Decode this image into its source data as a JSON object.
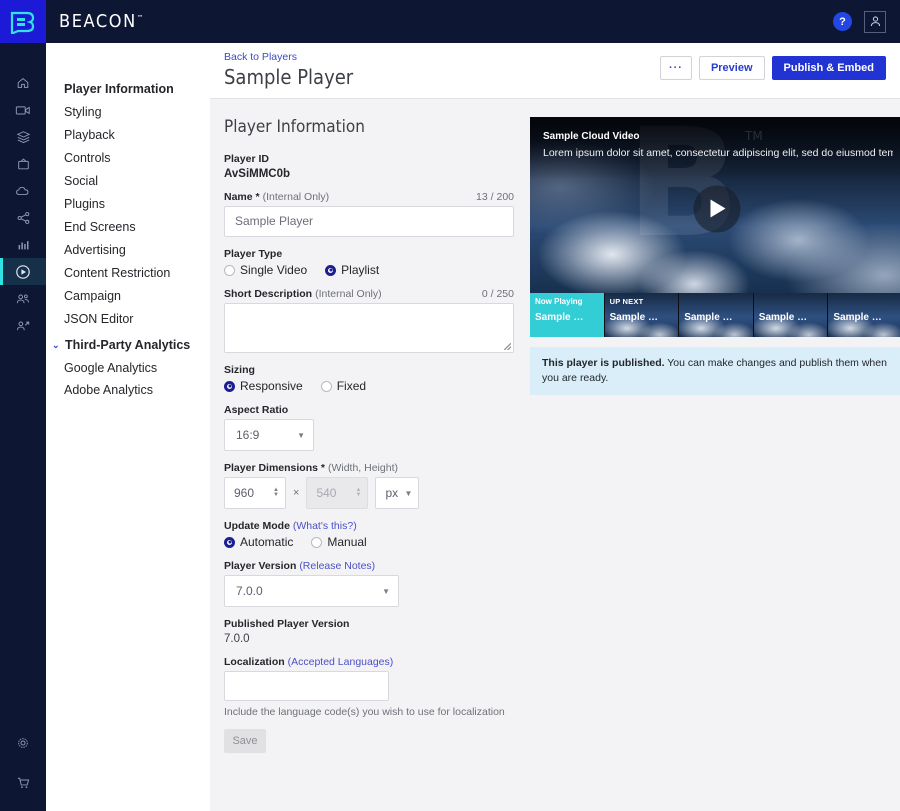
{
  "topbar": {
    "brand": "BEACON",
    "trademark": "™",
    "help_label": "?",
    "help_icon": "question-mark-icon",
    "account_icon": "user-account-icon",
    "bg_color": "#0d1733",
    "logo_tile_color": "#1c1ad6",
    "logo_mark_color": "#2fe3e3"
  },
  "rail": {
    "active_accent": "#2fe3e3",
    "items": [
      {
        "icon": "home-icon",
        "active": false
      },
      {
        "icon": "video-camera-icon",
        "active": false
      },
      {
        "icon": "layers-icon",
        "active": false
      },
      {
        "icon": "tv-icon",
        "active": false
      },
      {
        "icon": "cloud-icon",
        "active": false
      },
      {
        "icon": "share-icon",
        "active": false
      },
      {
        "icon": "bar-chart-icon",
        "active": false
      },
      {
        "icon": "play-circle-icon",
        "active": true
      },
      {
        "icon": "users-icon",
        "active": false
      },
      {
        "icon": "user-add-icon",
        "active": false
      }
    ],
    "bottom_items": [
      {
        "icon": "gear-icon"
      },
      {
        "icon": "shopping-cart-icon"
      }
    ]
  },
  "sidebar": {
    "items": [
      {
        "label": "Player Information",
        "active": true
      },
      {
        "label": "Styling",
        "active": false
      },
      {
        "label": "Playback",
        "active": false
      },
      {
        "label": "Controls",
        "active": false
      },
      {
        "label": "Social",
        "active": false
      },
      {
        "label": "Plugins",
        "active": false
      },
      {
        "label": "End Screens",
        "active": false
      },
      {
        "label": "Advertising",
        "active": false
      },
      {
        "label": "Content Restriction",
        "active": false
      },
      {
        "label": "Campaign",
        "active": false
      },
      {
        "label": "JSON Editor",
        "active": false
      }
    ],
    "group": {
      "label": "Third-Party Analytics",
      "chevron": "⌄",
      "expanded": true,
      "children": [
        {
          "label": "Google Analytics"
        },
        {
          "label": "Adobe Analytics"
        }
      ]
    }
  },
  "header": {
    "back_link": "Back to Players",
    "title": "Sample Player",
    "more_label": "···",
    "preview_label": "Preview",
    "publish_label": "Publish & Embed",
    "publish_color": "#2134d3"
  },
  "form": {
    "section_title": "Player Information",
    "player_id_label": "Player ID",
    "player_id_value": "AvSiMMC0b",
    "name_label": "Name *",
    "name_note": "(Internal Only)",
    "name_counter": "13 / 200",
    "name_value": "Sample Player",
    "player_type_label": "Player Type",
    "player_type_options": [
      {
        "label": "Single Video",
        "selected": false
      },
      {
        "label": "Playlist",
        "selected": true
      }
    ],
    "short_desc_label": "Short Description",
    "short_desc_note": "(Internal Only)",
    "short_desc_counter": "0 / 250",
    "short_desc_value": "",
    "sizing_label": "Sizing",
    "sizing_options": [
      {
        "label": "Responsive",
        "selected": true
      },
      {
        "label": "Fixed",
        "selected": false
      }
    ],
    "aspect_ratio_label": "Aspect Ratio",
    "aspect_ratio_value": "16:9",
    "dimensions_label": "Player Dimensions *",
    "dimensions_note": "(Width, Height)",
    "width_value": "960",
    "times_symbol": "×",
    "height_value": "540",
    "unit_value": "px",
    "update_mode_label": "Update Mode",
    "update_mode_link": "(What's this?)",
    "update_mode_options": [
      {
        "label": "Automatic",
        "selected": true
      },
      {
        "label": "Manual",
        "selected": false
      }
    ],
    "player_version_label": "Player Version",
    "player_version_link": "(Release Notes)",
    "player_version_value": "7.0.0",
    "published_version_label": "Published Player Version",
    "published_version_value": "7.0.0",
    "localization_label": "Localization",
    "localization_link": "(Accepted Languages)",
    "localization_value": "",
    "localization_hint": "Include the language code(s) you wish to use for localization",
    "save_label": "Save",
    "caret": "▼"
  },
  "preview": {
    "video_title": "Sample Cloud Video",
    "video_description": "Lorem ipsum dolor sit amet, consectetur adipiscing elit, sed do eiusmod tem…",
    "watermark": "B",
    "watermark_tm": "TM",
    "play_icon": "play-triangle-icon",
    "playlist": [
      {
        "tag": "Now Playing",
        "name": "Sample …",
        "now_playing": true
      },
      {
        "tag": "UP NEXT",
        "name": "Sample …",
        "now_playing": false
      },
      {
        "tag": "",
        "name": "Sample …",
        "now_playing": false
      },
      {
        "tag": "",
        "name": "Sample …",
        "now_playing": false
      },
      {
        "tag": "",
        "name": "Sample …",
        "now_playing": false
      }
    ],
    "banner_bold": "This player is published.",
    "banner_text": " You can make changes and publish them when you are ready.",
    "banner_color": "#d9eef9"
  }
}
